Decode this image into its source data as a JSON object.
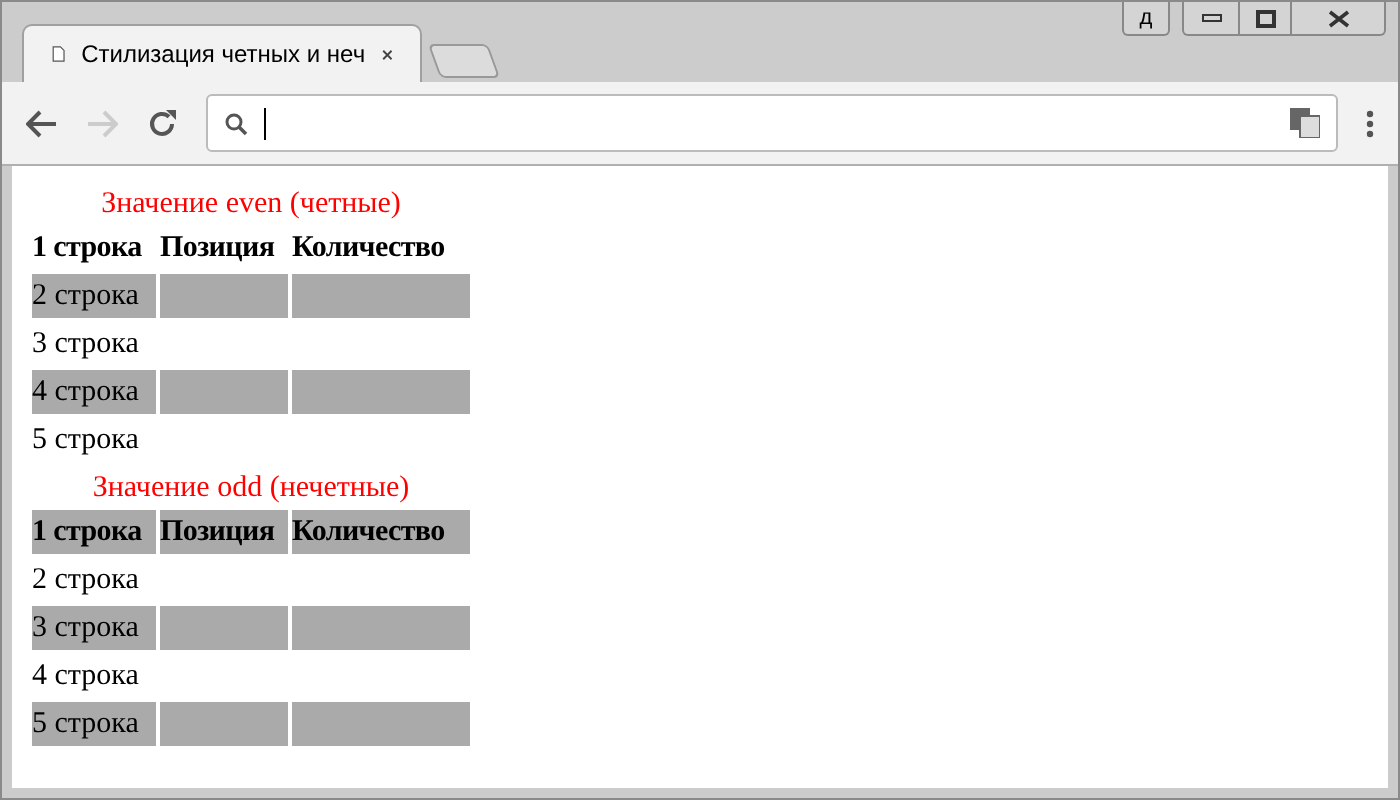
{
  "browser": {
    "profile_button": "д",
    "tab": {
      "title": "Стилизация четных и неч",
      "selected": true
    },
    "back_disabled": false,
    "forward_disabled": true
  },
  "tables": [
    {
      "caption": "Значение even (четные)",
      "header": {
        "cells": [
          "1 строка",
          "Позиция",
          "Количество"
        ],
        "shaded": false
      },
      "rows": [
        {
          "cells": [
            "2 строка"
          ],
          "shaded": true
        },
        {
          "cells": [
            "3 строка"
          ],
          "shaded": false
        },
        {
          "cells": [
            "4 строка"
          ],
          "shaded": true
        },
        {
          "cells": [
            "5 строка"
          ],
          "shaded": false
        }
      ]
    },
    {
      "caption": "Значение odd (нечетные)",
      "header": {
        "cells": [
          "1 строка",
          "Позиция",
          "Количество"
        ],
        "shaded": true
      },
      "rows": [
        {
          "cells": [
            "2 строка"
          ],
          "shaded": false
        },
        {
          "cells": [
            "3 строка"
          ],
          "shaded": true
        },
        {
          "cells": [
            "4 строка"
          ],
          "shaded": false
        },
        {
          "cells": [
            "5 строка"
          ],
          "shaded": true
        }
      ]
    }
  ]
}
